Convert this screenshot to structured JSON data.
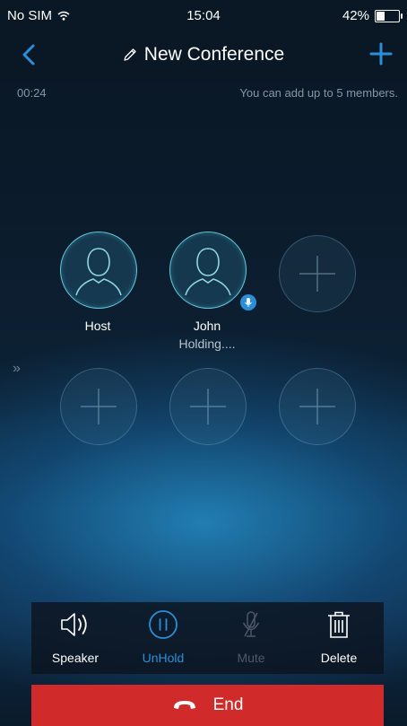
{
  "status": {
    "carrier": "No SIM",
    "time": "15:04",
    "battery": "42%",
    "battery_level": 0.42
  },
  "nav": {
    "title": "New Conference"
  },
  "call": {
    "timer": "00:24",
    "hint": "You can add up to 5 members."
  },
  "members": [
    {
      "name": "Host"
    },
    {
      "name": "John",
      "status": "Holding...."
    }
  ],
  "controls": {
    "speaker": "Speaker",
    "unhold": "UnHold",
    "mute": "Mute",
    "delete": "Delete",
    "end": "End"
  },
  "colors": {
    "accent": "#2a8fd8",
    "end": "#d02a2a",
    "ring": "#63c8dc",
    "muted": "#8596a6"
  },
  "icons": {
    "back": "chevron-left-icon",
    "add": "plus-icon",
    "edit": "pencil-icon",
    "speaker": "speaker-icon",
    "hold": "pause-icon",
    "mute": "microphone-icon",
    "delete": "trash-icon",
    "end": "phone-hangup-icon"
  }
}
